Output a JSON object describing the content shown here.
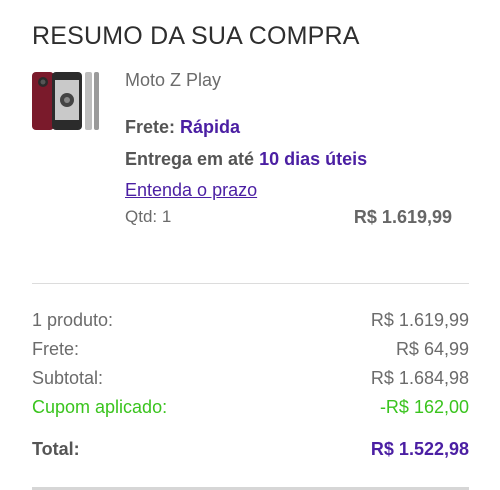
{
  "header": {
    "title": "RESUMO DA SUA COMPRA"
  },
  "product": {
    "name": "Moto Z Play",
    "shipping_label": "Frete:",
    "shipping_value": "Rápida",
    "delivery_label": "Entrega em até",
    "delivery_value": "10 dias úteis",
    "deadline_link": "Entenda o prazo",
    "qty": "Qtd: 1",
    "price": "R$ 1.619,99"
  },
  "summary": {
    "rows": [
      {
        "label": "1 produto:",
        "value": "R$ 1.619,99"
      },
      {
        "label": "Frete:",
        "value": "R$ 64,99"
      },
      {
        "label": "Subtotal:",
        "value": "R$ 1.684,98"
      },
      {
        "label": "Cupom aplicado:",
        "value": "-R$ 162,00"
      }
    ],
    "total_label": "Total:",
    "total_value": "R$ 1.522,98"
  },
  "colors": {
    "accent": "#4b1fa3",
    "coupon": "#3ac41e"
  }
}
